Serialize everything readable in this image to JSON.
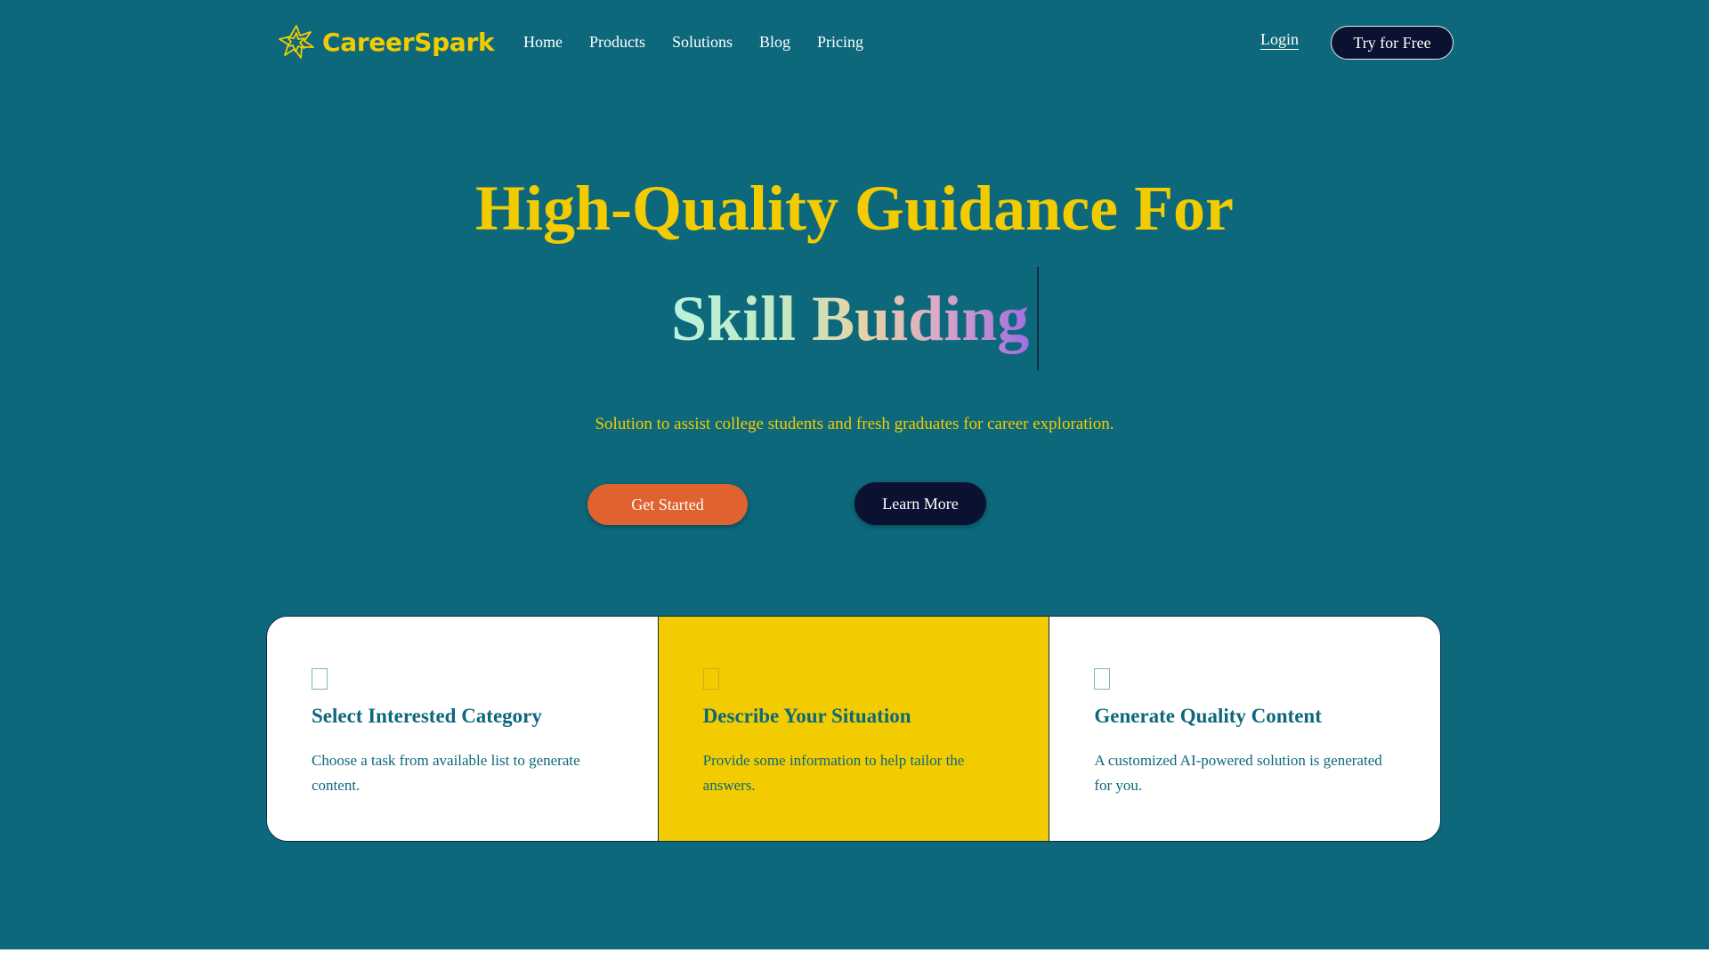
{
  "colors": {
    "background": "#0d687b",
    "accent_yellow": "#f2cc00",
    "accent_orange": "#e0622f",
    "dark_navy": "#0b1130",
    "card_text": "#0d687b",
    "white": "#ffffff"
  },
  "header": {
    "logo_icon": "spark-burst-icon",
    "logo_text": "CareerSpark",
    "nav": [
      "Home",
      "Products",
      "Solutions",
      "Blog",
      "Pricing"
    ],
    "login_label": "Login",
    "cta_label": "Try for Free"
  },
  "hero": {
    "headline_line1": "High-Quality Guidance For",
    "headline_line2": "Skill Buiding",
    "subtitle": "Solution to assist college students and fresh graduates for career exploration.",
    "primary_button": "Get Started",
    "secondary_button": "Learn More"
  },
  "steps": [
    {
      "icon": "placeholder-icon",
      "title": "Select Interested Category",
      "description": "Choose a task from available list to generate content."
    },
    {
      "icon": "placeholder-icon",
      "title": "Describe Your Situation",
      "description": "Provide some information to help tailor the answers."
    },
    {
      "icon": "placeholder-icon",
      "title": "Generate Quality Content",
      "description": "A customized AI-powered solution is generated for you."
    }
  ]
}
